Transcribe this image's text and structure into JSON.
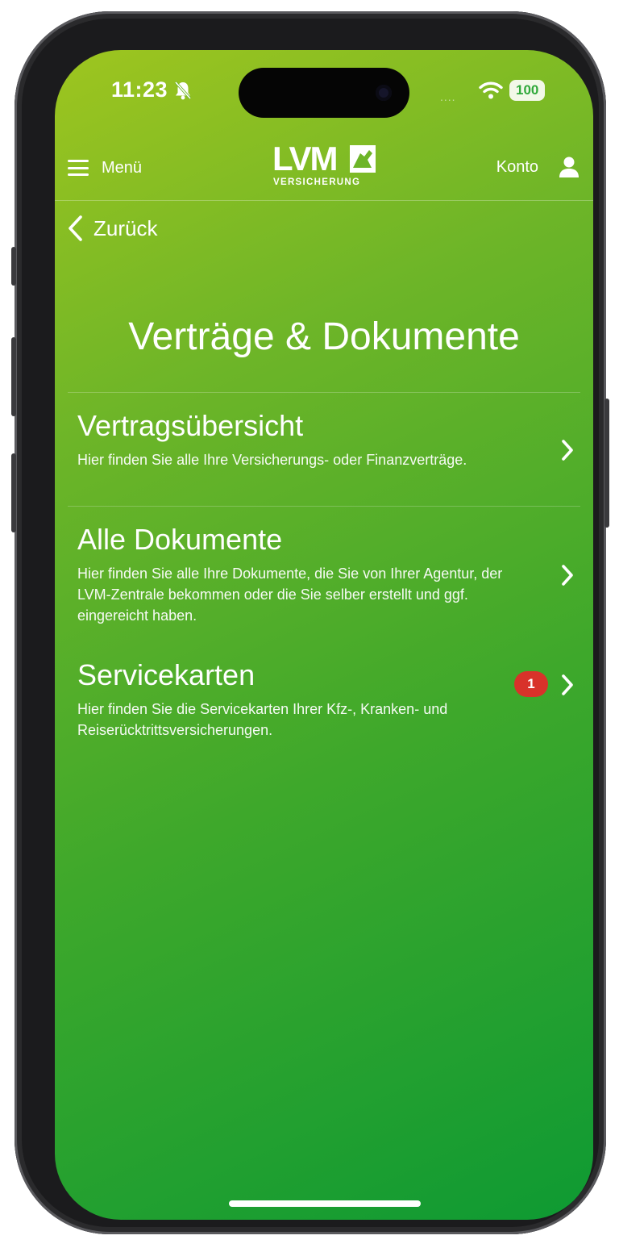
{
  "status_bar": {
    "time": "11:23",
    "battery": "100",
    "signal_dots": "....",
    "icons": [
      "bell-slash-icon",
      "wifi-icon",
      "battery-icon"
    ]
  },
  "header": {
    "menu_label": "Menü",
    "logo_main": "LVM",
    "logo_sub": "VERSICHERUNG",
    "account_label": "Konto"
  },
  "nav": {
    "back_label": "Zurück"
  },
  "page": {
    "title": "Verträge & Dokumente"
  },
  "items": [
    {
      "title": "Vertragsübersicht",
      "description": "Hier finden Sie alle Ihre Versicherungs- oder Finanzverträge."
    },
    {
      "title": "Alle Dokumente",
      "description": "Hier finden Sie alle Ihre Dokumente, die Sie von Ihrer Agentur, der LVM-Zentrale bekommen oder die Sie selber erstellt und ggf. eingereicht haben."
    },
    {
      "title": "Servicekarten",
      "description": "Hier finden Sie die Servicekarten Ihrer Kfz-, Kranken- und Reiserücktrittsversicherungen.",
      "badge": "1"
    }
  ],
  "colors": {
    "gradient_start": "#9ec51f",
    "gradient_end": "#0e9a33",
    "badge": "#d8322a",
    "text": "#ffffff"
  }
}
